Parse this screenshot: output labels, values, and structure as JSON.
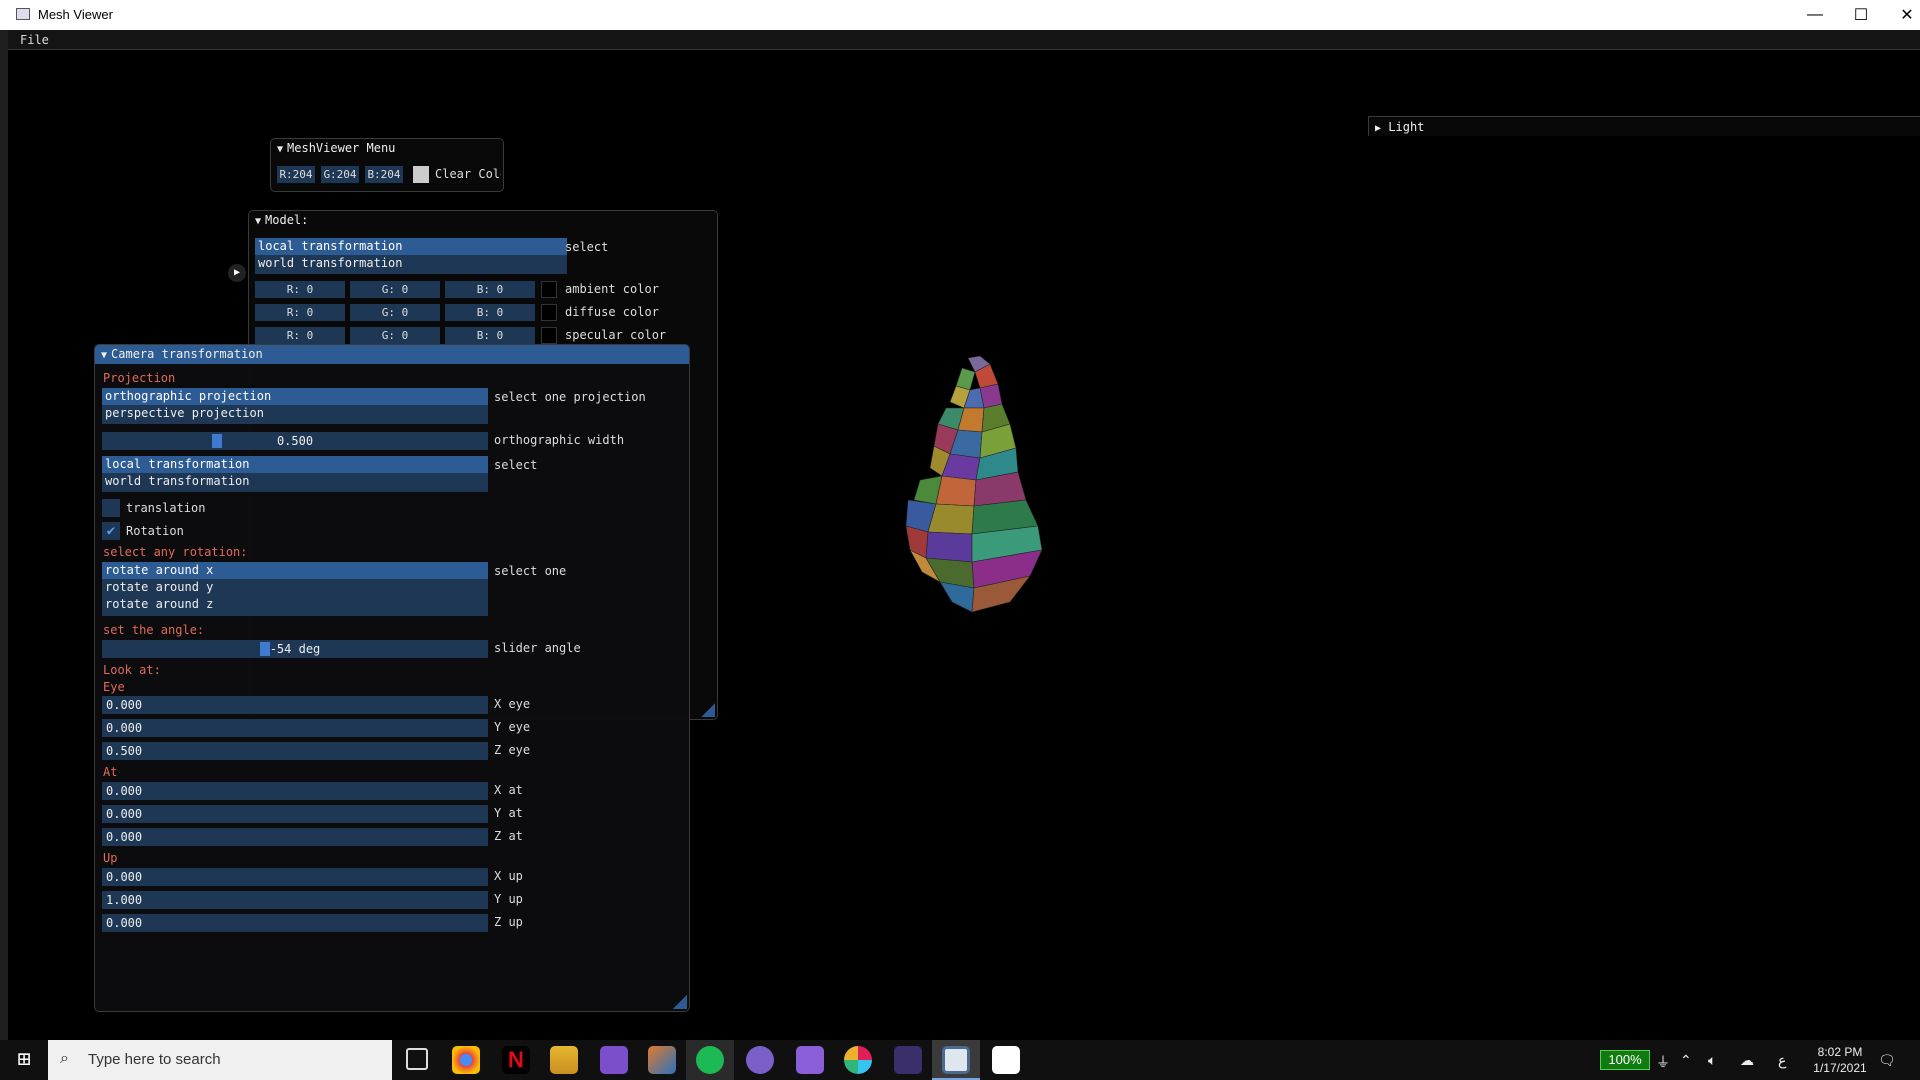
{
  "window": {
    "title": "Mesh Viewer",
    "minimize": "—",
    "maximize": "☐",
    "close": "✕"
  },
  "menubar": {
    "file": "File"
  },
  "light_panel": {
    "label": "Light"
  },
  "meshviewer_menu": {
    "title": "MeshViewer Menu",
    "r": "R:204",
    "g": "G:204",
    "b": "B:204",
    "clear_label": "Clear Colo",
    "swatch_color": "#cccccc"
  },
  "model_panel": {
    "title": "Model:",
    "transform_options": [
      "local transformation",
      "world transformation"
    ],
    "transform_label": "select",
    "colors": [
      {
        "r": "R:  0",
        "g": "G:  0",
        "b": "B:  0",
        "label": "ambient color"
      },
      {
        "r": "R:  0",
        "g": "G:  0",
        "b": "B:  0",
        "label": "diffuse color"
      },
      {
        "r": "R:  0",
        "g": "G:  0",
        "b": "B:  0",
        "label": "specular color"
      }
    ]
  },
  "camera_panel": {
    "title": "Camera transformation",
    "projection_header": "Projection",
    "projection_options": [
      "orthographic projection",
      "perspective projection"
    ],
    "projection_label": "select one projection",
    "ortho_width_value": "0.500",
    "ortho_width_label": "orthographic width",
    "ortho_width_fraction": 0.29,
    "transform_options": [
      "local transformation",
      "world transformation"
    ],
    "transform_label": "select",
    "translation_label": "translation",
    "translation_checked": false,
    "rotation_label": "Rotation",
    "rotation_checked": true,
    "rotation_header": "select any rotation:",
    "rotation_options": [
      "rotate around x",
      "rotate around y",
      "rotate around z"
    ],
    "rotation_select_label": "select one",
    "angle_header": "set the angle:",
    "angle_value": "-54 deg",
    "angle_label": "slider angle",
    "angle_fraction": 0.42,
    "lookat_header": "Look at:",
    "eye_header": "Eye",
    "eye": [
      {
        "value": "0.000",
        "label": "X eye"
      },
      {
        "value": "0.000",
        "label": "Y eye"
      },
      {
        "value": "0.500",
        "label": "Z eye"
      }
    ],
    "at_header": "At",
    "at": [
      {
        "value": "0.000",
        "label": "X at"
      },
      {
        "value": "0.000",
        "label": "Y at"
      },
      {
        "value": "0.000",
        "label": "Z at"
      }
    ],
    "up_header": "Up",
    "up": [
      {
        "value": "0.000",
        "label": "X up"
      },
      {
        "value": "1.000",
        "label": "Y up"
      },
      {
        "value": "0.000",
        "label": "Z up"
      }
    ]
  },
  "taskbar": {
    "search_placeholder": "Type here to search",
    "battery": "100%",
    "time": "8:02 PM",
    "date": "1/17/2021",
    "ime": "ع",
    "apps": [
      "task-view",
      "chrome",
      "netflix",
      "file-explorer",
      "visual-studio",
      "matlab",
      "spotify",
      "discord",
      "visual-studio-2",
      "slack",
      "terminal",
      "mesh-viewer",
      "photos"
    ]
  }
}
